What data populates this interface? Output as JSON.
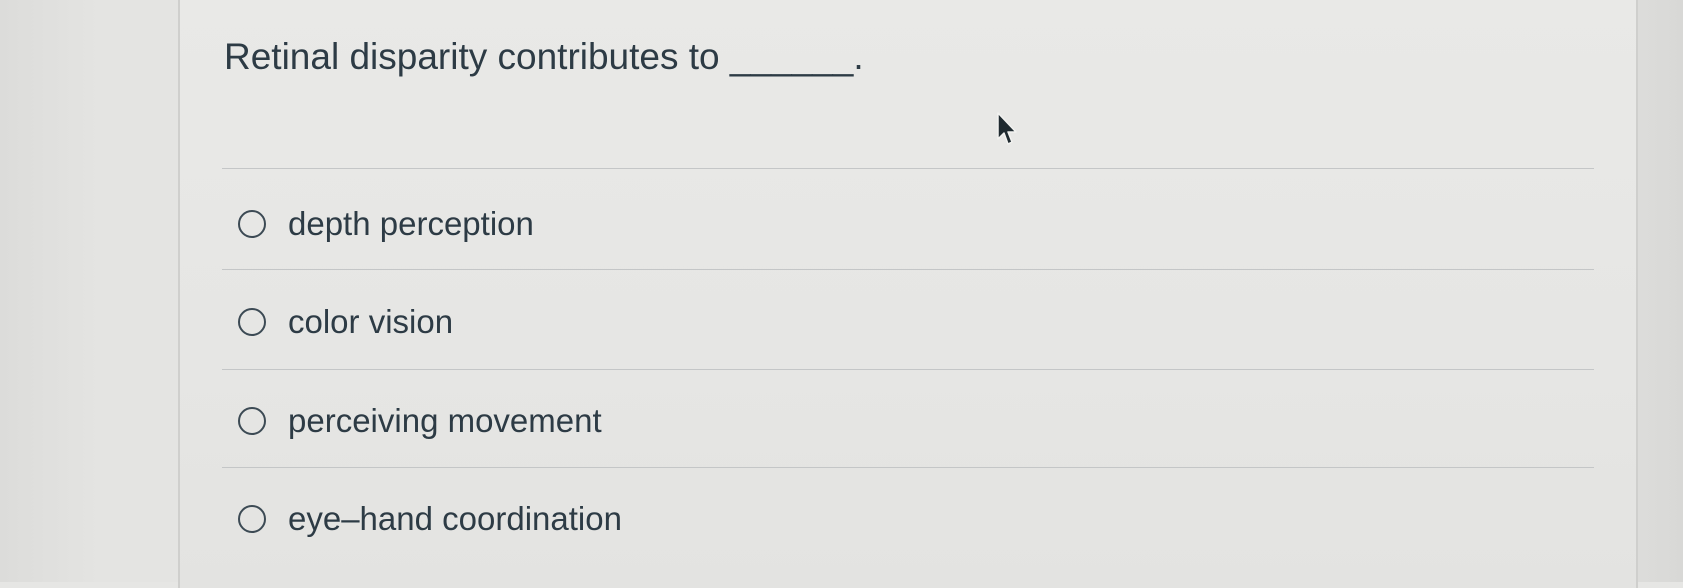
{
  "question": {
    "text": "Retinal disparity contributes to ______."
  },
  "answers": [
    {
      "label": "depth perception",
      "selected": false
    },
    {
      "label": "color vision",
      "selected": false
    },
    {
      "label": "perceiving movement",
      "selected": false
    },
    {
      "label": "eye–hand coordination",
      "selected": false
    }
  ],
  "colors": {
    "text": "#2d3b45",
    "background": "#e6e6e4",
    "divider": "#c4c6c7"
  },
  "icons": {
    "cursor": "mouse-pointer-icon",
    "radio": "radio-button-icon"
  }
}
